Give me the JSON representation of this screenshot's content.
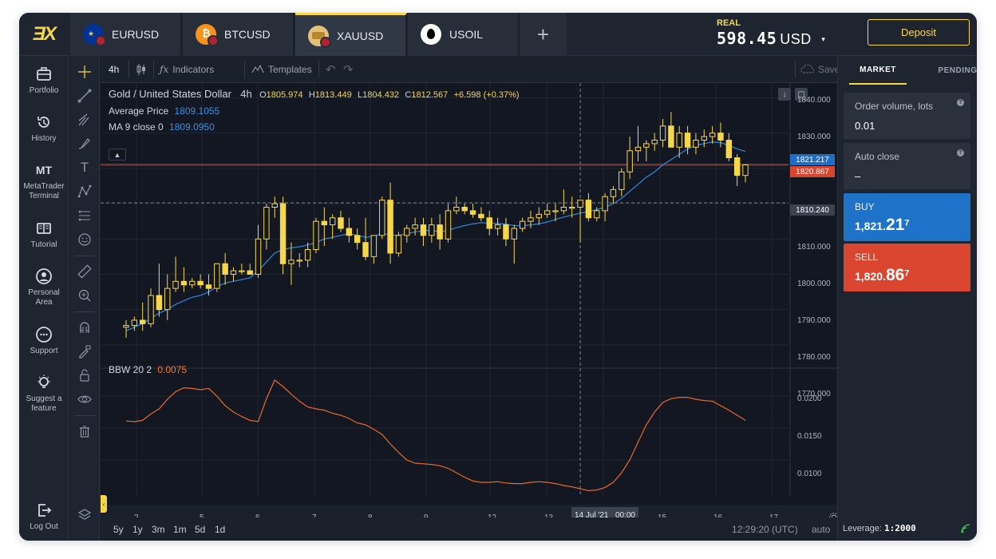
{
  "header": {
    "logo_text": "ƎX",
    "tabs": [
      {
        "label": "EURUSD",
        "active": false,
        "flag_colors": [
          "#003399",
          "#b22234"
        ]
      },
      {
        "label": "BTCUSD",
        "active": false,
        "flag_colors": [
          "#f7931a",
          "#b22234"
        ]
      },
      {
        "label": "XAUUSD",
        "active": true,
        "flag_colors": [
          "#d4a84a",
          "#b22234"
        ]
      },
      {
        "label": "USOIL",
        "active": false,
        "flag_colors": [
          "#ffffff",
          "#000000"
        ]
      }
    ],
    "add_tab_label": "+",
    "account_type": "REAL",
    "balance": "598.45",
    "currency": "USD",
    "deposit_label": "Deposit"
  },
  "nav": {
    "items": [
      {
        "label": "Portfolio",
        "icon": "briefcase-icon"
      },
      {
        "label": "History",
        "icon": "history-icon"
      },
      {
        "label": "MetaTrader Terminal",
        "icon_text": "MT",
        "line1": "MetaTrader",
        "line2": "Terminal"
      },
      {
        "label": "Tutorial",
        "icon": "book-icon"
      },
      {
        "label": "Personal Area",
        "icon": "user-icon",
        "line1": "Personal",
        "line2": "Area"
      },
      {
        "label": "Support",
        "icon": "chat-icon"
      },
      {
        "label": "Suggest a feature",
        "icon": "bulb-icon",
        "line1": "Suggest a",
        "line2": "feature"
      },
      {
        "label": "Log Out",
        "icon": "logout-icon"
      }
    ]
  },
  "chart_toolbar": {
    "timeframe": "4h",
    "indicators_label": "Indicators",
    "templates_label": "Templates",
    "save_label": "Save"
  },
  "chart_legend": {
    "title": "Gold / United States Dollar",
    "interval": "4h",
    "open_label": "O",
    "open": "1805.974",
    "high_label": "H",
    "high": "1813.449",
    "low_label": "L",
    "low": "1804.432",
    "close_label": "C",
    "close": "1812.567",
    "change": "+6.598 (+0.37%)",
    "average_label": "Average Price",
    "average_value": "1809.1055",
    "ma_label": "MA 9 close 0",
    "ma_value": "1809.0950",
    "bbw_label": "BBW 20 2",
    "bbw_value": "0.0075",
    "colors": {
      "up": "#f7d74a",
      "ma": "#2f7fcf",
      "bbw": "#e8692a",
      "ask_tag": "#1e6ec8",
      "bid_tag": "#d9452f"
    }
  },
  "chart_data": {
    "type": "candlestick",
    "symbol": "XAUUSD",
    "ylim": [
      1765,
      1841
    ],
    "price_ticks": [
      "1840.000",
      "1830.000",
      "1820.000",
      "1810.000",
      "1800.000",
      "1790.000",
      "1780.000",
      "1770.000"
    ],
    "x_ticks": [
      "2",
      "5",
      "6",
      "7",
      "8",
      "9",
      "12",
      "13",
      "15",
      "16",
      "17"
    ],
    "x_hover_label": "14 Jul '21",
    "x_hover_time": "00:00",
    "ask_price": "1821.217",
    "bid_price": "1820.867",
    "crosshair_price": "1810.240",
    "candles": [
      [
        1775.0,
        1777.0,
        1772.0,
        1775.5
      ],
      [
        1775.5,
        1778.0,
        1774.0,
        1777.0
      ],
      [
        1777.0,
        1782.0,
        1774.0,
        1776.0
      ],
      [
        1776.0,
        1786.0,
        1775.0,
        1784.0
      ],
      [
        1784.0,
        1793.0,
        1778.0,
        1780.0
      ],
      [
        1780.0,
        1790.0,
        1777.0,
        1786.0
      ],
      [
        1786.0,
        1795.0,
        1785.0,
        1788.0
      ],
      [
        1788.0,
        1792.0,
        1785.0,
        1787.0
      ],
      [
        1787.0,
        1789.0,
        1786.0,
        1788.0
      ],
      [
        1788.0,
        1790.0,
        1786.0,
        1787.0
      ],
      [
        1787.0,
        1790.0,
        1784.0,
        1786.0
      ],
      [
        1786.0,
        1793.0,
        1785.0,
        1793.0
      ],
      [
        1793.0,
        1796.0,
        1787.0,
        1790.0
      ],
      [
        1790.0,
        1792.0,
        1788.0,
        1791.0
      ],
      [
        1791.0,
        1793.0,
        1790.0,
        1791.0
      ],
      [
        1791.0,
        1793.0,
        1790.0,
        1790.0
      ],
      [
        1790.0,
        1804.0,
        1789.0,
        1800.0
      ],
      [
        1800.0,
        1810.0,
        1797.0,
        1809.0
      ],
      [
        1809.0,
        1812.0,
        1806.0,
        1810.0
      ],
      [
        1810.0,
        1812.0,
        1790.0,
        1793.0
      ],
      [
        1793.0,
        1799.0,
        1787.0,
        1794.0
      ],
      [
        1794.0,
        1796.0,
        1792.0,
        1794.0
      ],
      [
        1794.0,
        1799.0,
        1792.0,
        1797.0
      ],
      [
        1797.0,
        1806.0,
        1796.0,
        1805.0
      ],
      [
        1805.0,
        1809.0,
        1798.0,
        1804.0
      ],
      [
        1804.0,
        1807.0,
        1800.0,
        1806.0
      ],
      [
        1806.0,
        1808.0,
        1802.0,
        1803.0
      ],
      [
        1803.0,
        1806.0,
        1799.0,
        1801.0
      ],
      [
        1801.0,
        1803.0,
        1797.0,
        1799.0
      ],
      [
        1799.0,
        1806.0,
        1794.0,
        1795.0
      ],
      [
        1795.0,
        1801.0,
        1793.0,
        1801.0
      ],
      [
        1801.0,
        1812.0,
        1800.0,
        1811.0
      ],
      [
        1811.0,
        1816.0,
        1793.0,
        1796.0
      ],
      [
        1796.0,
        1802.0,
        1795.0,
        1801.0
      ],
      [
        1801.0,
        1804.0,
        1799.0,
        1803.0
      ],
      [
        1803.0,
        1806.0,
        1801.0,
        1804.0
      ],
      [
        1804.0,
        1806.0,
        1798.0,
        1801.0
      ],
      [
        1801.0,
        1806.0,
        1799.0,
        1804.0
      ],
      [
        1804.0,
        1807.0,
        1797.0,
        1800.0
      ],
      [
        1800.0,
        1810.0,
        1799.0,
        1808.0
      ],
      [
        1808.0,
        1812.0,
        1807.0,
        1809.0
      ],
      [
        1809.0,
        1810.0,
        1807.0,
        1808.0
      ],
      [
        1808.0,
        1810.0,
        1806.0,
        1807.0
      ],
      [
        1807.0,
        1809.0,
        1805.0,
        1806.0
      ],
      [
        1806.0,
        1808.0,
        1801.0,
        1803.0
      ],
      [
        1803.0,
        1806.0,
        1801.0,
        1804.0
      ],
      [
        1804.0,
        1806.0,
        1798.0,
        1800.0
      ],
      [
        1800.0,
        1804.0,
        1793.0,
        1803.0
      ],
      [
        1803.0,
        1806.0,
        1802.0,
        1805.0
      ],
      [
        1805.0,
        1808.0,
        1803.0,
        1806.0
      ],
      [
        1806.0,
        1809.0,
        1804.0,
        1807.0
      ],
      [
        1807.0,
        1810.0,
        1806.0,
        1808.0
      ],
      [
        1808.0,
        1810.0,
        1805.0,
        1808.0
      ],
      [
        1808.0,
        1814.0,
        1807.0,
        1809.0
      ],
      [
        1809.0,
        1812.0,
        1806.0,
        1809.0
      ],
      [
        1809.0,
        1811.0,
        1799.0,
        1811.0
      ],
      [
        1811.0,
        1813.0,
        1805.0,
        1806.0
      ],
      [
        1806.0,
        1809.0,
        1805.0,
        1808.0
      ],
      [
        1808.0,
        1813.0,
        1805.0,
        1812.0
      ],
      [
        1812.0,
        1815.0,
        1810.0,
        1814.0
      ],
      [
        1814.0,
        1820.0,
        1812.0,
        1819.0
      ],
      [
        1819.0,
        1829.0,
        1817.0,
        1825.0
      ],
      [
        1825.0,
        1832.0,
        1822.0,
        1826.0
      ],
      [
        1826.0,
        1828.0,
        1822.0,
        1827.0
      ],
      [
        1827.0,
        1830.0,
        1825.0,
        1828.0
      ],
      [
        1828.0,
        1834.0,
        1826.0,
        1832.0
      ],
      [
        1832.0,
        1836.0,
        1828.0,
        1826.0
      ],
      [
        1826.0,
        1832.0,
        1823.0,
        1830.0
      ],
      [
        1830.0,
        1832.0,
        1824.0,
        1826.0
      ],
      [
        1826.0,
        1830.0,
        1824.0,
        1828.0
      ],
      [
        1828.0,
        1831.0,
        1826.0,
        1829.0
      ],
      [
        1829.0,
        1832.0,
        1827.0,
        1830.0
      ],
      [
        1830.0,
        1833.0,
        1826.0,
        1828.0
      ],
      [
        1828.0,
        1830.0,
        1822.0,
        1823.0
      ],
      [
        1823.0,
        1824.0,
        1815.0,
        1818.0
      ],
      [
        1818.0,
        1821.0,
        1816.0,
        1821.0
      ]
    ],
    "ma_values": [
      1774.0,
      1775.0,
      1776.0,
      1777.5,
      1779.0,
      1780.0,
      1781.5,
      1782.5,
      1783.5,
      1784.0,
      1785.0,
      1786.5,
      1787.5,
      1788.0,
      1788.5,
      1789.0,
      1791.0,
      1793.5,
      1796.0,
      1797.0,
      1797.5,
      1797.8,
      1798.3,
      1799.0,
      1800.0,
      1800.5,
      1801.0,
      1801.5,
      1801.0,
      1800.5,
      1800.8,
      1801.5,
      1801.2,
      1801.0,
      1801.5,
      1802.0,
      1802.3,
      1802.5,
      1802.0,
      1802.5,
      1803.2,
      1803.8,
      1804.3,
      1804.6,
      1804.5,
      1804.4,
      1804.2,
      1803.8,
      1803.8,
      1804.0,
      1804.3,
      1804.8,
      1805.5,
      1806.2,
      1806.8,
      1807.3,
      1807.8,
      1808.3,
      1809.0,
      1810.0,
      1811.5,
      1813.5,
      1815.5,
      1817.5,
      1819.0,
      1821.0,
      1822.5,
      1824.0,
      1825.5,
      1826.5,
      1827.0,
      1827.5,
      1827.3,
      1826.5,
      1825.5,
      1824.8
    ],
    "bbw_ylim": [
      0.004,
      0.024
    ],
    "bbw_ticks": [
      "0.0200",
      "0.0150",
      "0.0100"
    ],
    "bbw_values": [
      0.0161,
      0.016,
      0.0162,
      0.0172,
      0.018,
      0.0195,
      0.0207,
      0.0213,
      0.0212,
      0.021,
      0.0212,
      0.02,
      0.0185,
      0.0175,
      0.0168,
      0.0162,
      0.016,
      0.0196,
      0.0225,
      0.0215,
      0.0203,
      0.0192,
      0.0183,
      0.018,
      0.0178,
      0.0173,
      0.017,
      0.0165,
      0.0158,
      0.0155,
      0.0148,
      0.014,
      0.0125,
      0.0112,
      0.01,
      0.0095,
      0.0094,
      0.0093,
      0.0091,
      0.0087,
      0.008,
      0.0073,
      0.0067,
      0.0065,
      0.0065,
      0.0066,
      0.0064,
      0.0063,
      0.0063,
      0.0065,
      0.0066,
      0.0065,
      0.0063,
      0.006,
      0.0058,
      0.0055,
      0.0052,
      0.0053,
      0.0057,
      0.0065,
      0.008,
      0.01,
      0.0128,
      0.0155,
      0.0175,
      0.019,
      0.0196,
      0.0198,
      0.0198,
      0.0195,
      0.0193,
      0.0192,
      0.0185,
      0.0178,
      0.017,
      0.0162
    ]
  },
  "bottom_bar": {
    "ranges": [
      "5y",
      "1y",
      "3m",
      "1m",
      "5d",
      "1d"
    ],
    "time": "12:29:20 (UTC)",
    "scale_mode": "auto"
  },
  "right_panel": {
    "tabs": [
      {
        "label": "MARKET",
        "active": true
      },
      {
        "label": "PENDING",
        "active": false
      }
    ],
    "order_volume_label": "Order volume, lots",
    "order_volume_value": "0.01",
    "auto_close_label": "Auto close",
    "auto_close_value": "–",
    "help_glyph": "?",
    "buy_label": "BUY",
    "buy_price_main": "1,821.",
    "buy_price_big": "21",
    "buy_price_sup": "7",
    "sell_label": "SELL",
    "sell_price_main": "1,820.",
    "sell_price_big": "86",
    "sell_price_sup": "7",
    "buy_color": "#1e72c8",
    "sell_color": "#d9452f",
    "leverage_label": "Leverage:",
    "leverage_value": "1:2000"
  }
}
